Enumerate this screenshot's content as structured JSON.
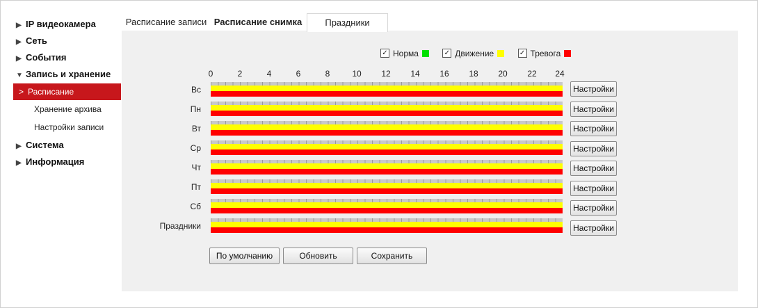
{
  "sidebar": {
    "items": [
      {
        "label": "IP видеокамера",
        "expanded": false
      },
      {
        "label": "Сеть",
        "expanded": false
      },
      {
        "label": "События",
        "expanded": false
      },
      {
        "label": "Запись и хранение",
        "expanded": true
      },
      {
        "label": "Система",
        "expanded": false
      },
      {
        "label": "Информация",
        "expanded": false
      }
    ],
    "subitems": [
      {
        "label": "Расписание",
        "active": true
      },
      {
        "label": "Хранение архива",
        "active": false
      },
      {
        "label": "Настройки записи",
        "active": false
      }
    ],
    "collapsed_glyph": "▶",
    "expanded_glyph": "▼",
    "active_glyph": ">"
  },
  "tabs": [
    {
      "label": "Расписание записи",
      "active": false
    },
    {
      "label": "Расписание снимка",
      "active": true
    },
    {
      "label": "Праздники",
      "active": false
    }
  ],
  "legend": [
    {
      "label": "Норма",
      "checked": true,
      "color": "#00e000"
    },
    {
      "label": "Движение",
      "checked": true,
      "color": "#ffff00"
    },
    {
      "label": "Тревога",
      "checked": true,
      "color": "#ff0000"
    }
  ],
  "hours": [
    "0",
    "2",
    "4",
    "6",
    "8",
    "10",
    "12",
    "14",
    "16",
    "18",
    "20",
    "22",
    "24"
  ],
  "days": [
    {
      "label": "Вс",
      "button": "Настройки"
    },
    {
      "label": "Пн",
      "button": "Настройки"
    },
    {
      "label": "Вт",
      "button": "Настройки"
    },
    {
      "label": "Ср",
      "button": "Настройки"
    },
    {
      "label": "Чт",
      "button": "Настройки"
    },
    {
      "label": "Пт",
      "button": "Настройки"
    },
    {
      "label": "Сб",
      "button": "Настройки"
    },
    {
      "label": "Праздники",
      "button": "Настройки"
    }
  ],
  "actions": {
    "default_label": "По умолчанию",
    "refresh_label": "Обновить",
    "save_label": "Сохранить"
  },
  "colors": {
    "accent": "#c7171c",
    "motion": "#ffff00",
    "alarm": "#ff0000",
    "normal": "#00e000"
  }
}
